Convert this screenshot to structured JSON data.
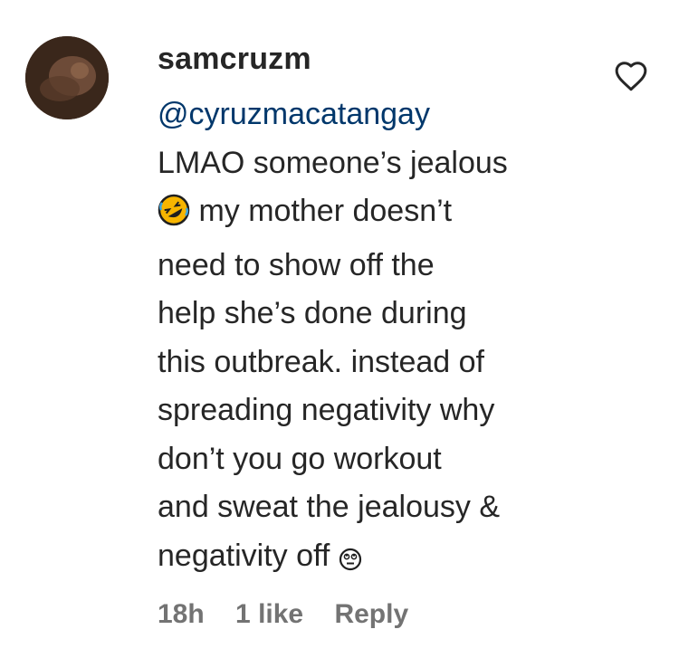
{
  "comment": {
    "username": "samcruzm",
    "mention": "@cyruzmacatangay",
    "lines": [
      "LMAO someone’s jealous",
      " my mother doesn’t",
      "need to show off the",
      "help she’s done during",
      "this outbreak. instead of",
      "spreading negativity why",
      "don’t you go workout",
      "and sweat the jealousy &",
      "negativity off"
    ],
    "emojis": [
      "rolling-on-floor-laughing-emoji",
      "face-with-rolling-eyes-emoji"
    ]
  },
  "footer": {
    "time": "18h",
    "likes": "1 like",
    "reply": "Reply"
  },
  "icons": {
    "like": "heart-outline-icon"
  },
  "colors": {
    "text": "#262626",
    "mention": "#00376b",
    "meta": "#737373"
  }
}
